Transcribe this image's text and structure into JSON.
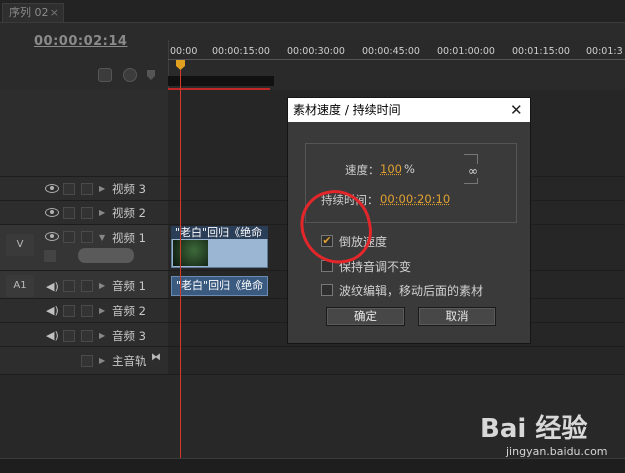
{
  "tab": {
    "title": "序列 02",
    "close": "×"
  },
  "timecode": "00:00:02:14",
  "ruler": {
    "ticks": [
      "00:00",
      "00:00:15:00",
      "00:00:30:00",
      "00:00:45:00",
      "00:01:00:00",
      "00:01:15:00",
      "00:01:3"
    ]
  },
  "tracks": {
    "v_label": "V",
    "a_label": "A1",
    "video": [
      "视频 3",
      "视频 2",
      "视频 1"
    ],
    "audio": [
      "音频 1",
      "音频 2",
      "音频 3"
    ],
    "master": "主音轨"
  },
  "clips": {
    "video_title": "\"老白\"回归《绝命",
    "audio_title": "\"老白\"回归《绝命"
  },
  "dialog": {
    "title": "素材速度 / 持续时间",
    "close": "✕",
    "speed_label": "速度：",
    "speed_value": "100",
    "speed_unit": "%",
    "duration_label": "持续时间：",
    "duration_value": "00:00:20:10",
    "reverse_label": "倒放速度",
    "reverse_checked": true,
    "keep_pitch_label": "保持音调不变",
    "ripple_label": "波纹编辑，移动后面的素材",
    "ok": "确定",
    "cancel": "取消"
  },
  "watermark": {
    "logo": "Bai 经验",
    "url": "jingyan.baidu.com"
  },
  "colors": {
    "accent": "#e0a030",
    "playhead": "#d23a2a",
    "annotation": "#e3262a"
  }
}
